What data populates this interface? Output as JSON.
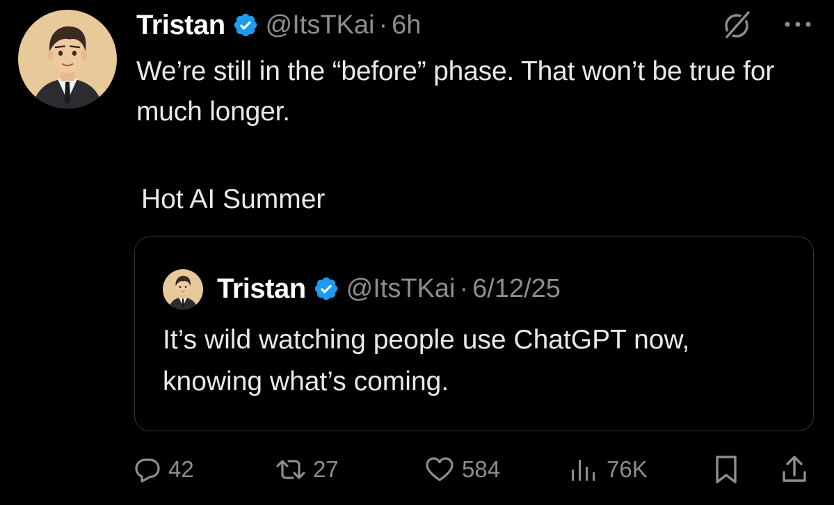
{
  "tweet": {
    "author_name": "Tristan",
    "handle": "@ItsTKai",
    "separator": "·",
    "time": "6h",
    "text": "We’re still in the “before” phase. That won’t be true for much longer.",
    "quote_comment": "Hot AI Summer"
  },
  "quoted_tweet": {
    "author_name": "Tristan",
    "handle": "@ItsTKai",
    "separator": "·",
    "date": "6/12/25",
    "text": "It’s wild watching people use ChatGPT now, knowing what’s coming."
  },
  "actions": {
    "replies": "42",
    "retweets": "27",
    "likes": "584",
    "views": "76K"
  },
  "icons": {
    "verified": "verified-badge-icon",
    "grok": "grok-icon",
    "more": "more-options-icon",
    "reply": "reply-icon",
    "retweet": "retweet-icon",
    "like": "heart-icon",
    "views": "views-chart-icon",
    "bookmark": "bookmark-icon",
    "share": "share-icon"
  },
  "colors": {
    "background": "#000000",
    "text_primary": "#e7e9ea",
    "text_secondary": "#8b8f94",
    "verified_blue": "#1d9bf0",
    "border": "#333639"
  }
}
